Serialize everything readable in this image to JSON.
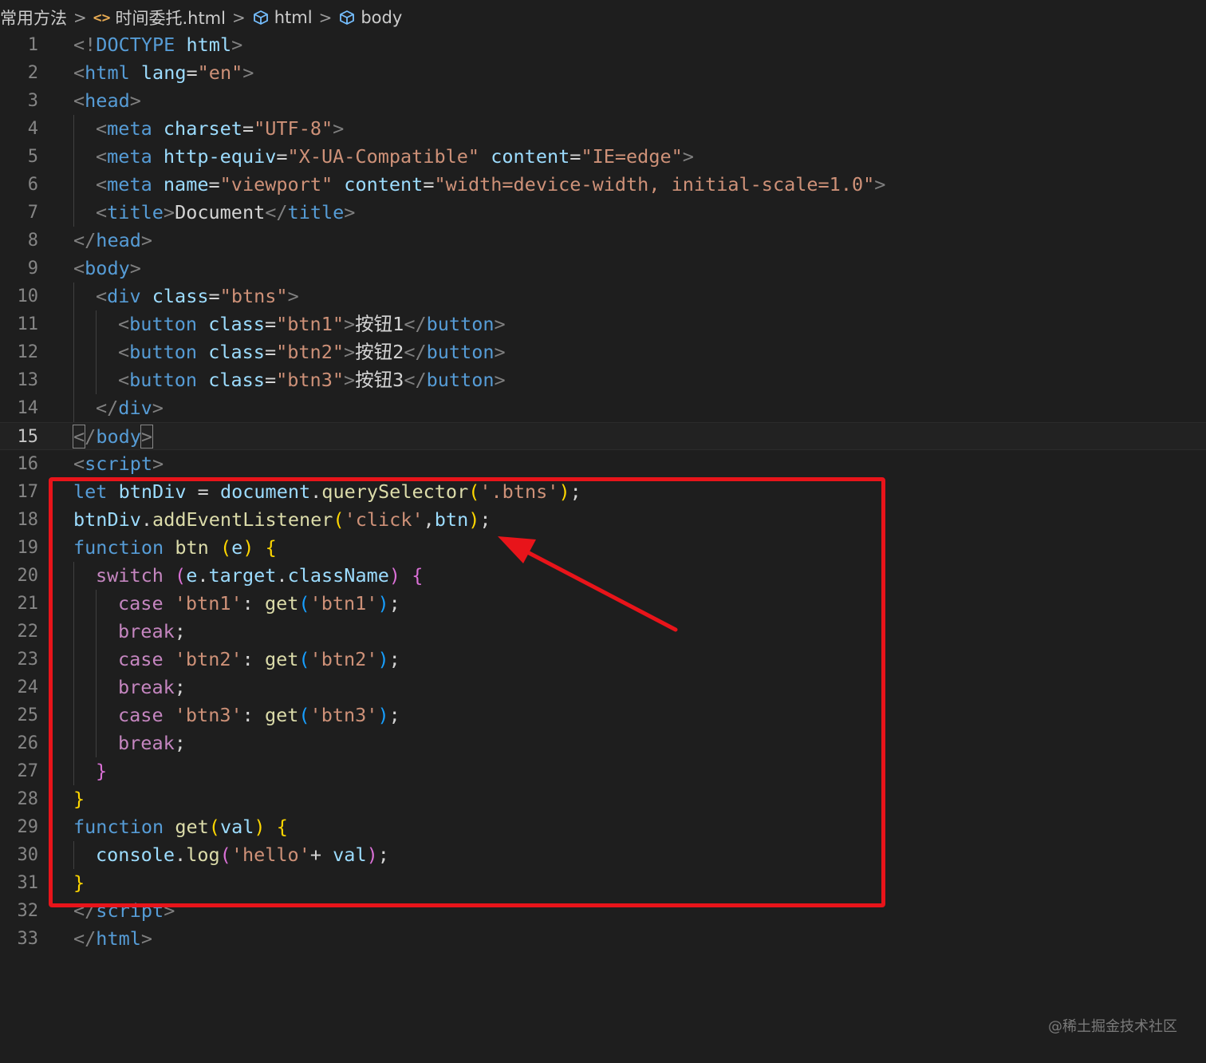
{
  "breadcrumb": {
    "folder": "常用方法",
    "file": "时间委托.html",
    "file_icon": "<>",
    "node1": "html",
    "node2": "body",
    "separator": ">"
  },
  "editor": {
    "current_line": 15,
    "lines": [
      {
        "n": "1",
        "indent": 0,
        "tokens": [
          [
            "punc",
            "<!"
          ],
          [
            "tag",
            "DOCTYPE"
          ],
          [
            "text",
            " "
          ],
          [
            "attr",
            "html"
          ],
          [
            "punc",
            ">"
          ]
        ]
      },
      {
        "n": "2",
        "indent": 0,
        "tokens": [
          [
            "punc",
            "<"
          ],
          [
            "tag",
            "html"
          ],
          [
            "text",
            " "
          ],
          [
            "attr",
            "lang"
          ],
          [
            "text",
            "="
          ],
          [
            "str",
            "\"en\""
          ],
          [
            "punc",
            ">"
          ]
        ]
      },
      {
        "n": "3",
        "indent": 0,
        "tokens": [
          [
            "punc",
            "<"
          ],
          [
            "tag",
            "head"
          ],
          [
            "punc",
            ">"
          ]
        ]
      },
      {
        "n": "4",
        "indent": 1,
        "tokens": [
          [
            "punc",
            "<"
          ],
          [
            "tag",
            "meta"
          ],
          [
            "text",
            " "
          ],
          [
            "attr",
            "charset"
          ],
          [
            "text",
            "="
          ],
          [
            "str",
            "\"UTF-8\""
          ],
          [
            "punc",
            ">"
          ]
        ]
      },
      {
        "n": "5",
        "indent": 1,
        "tokens": [
          [
            "punc",
            "<"
          ],
          [
            "tag",
            "meta"
          ],
          [
            "text",
            " "
          ],
          [
            "attr",
            "http-equiv"
          ],
          [
            "text",
            "="
          ],
          [
            "str",
            "\"X-UA-Compatible\""
          ],
          [
            "text",
            " "
          ],
          [
            "attr",
            "content"
          ],
          [
            "text",
            "="
          ],
          [
            "str",
            "\"IE=edge\""
          ],
          [
            "punc",
            ">"
          ]
        ]
      },
      {
        "n": "6",
        "indent": 1,
        "tokens": [
          [
            "punc",
            "<"
          ],
          [
            "tag",
            "meta"
          ],
          [
            "text",
            " "
          ],
          [
            "attr",
            "name"
          ],
          [
            "text",
            "="
          ],
          [
            "str",
            "\"viewport\""
          ],
          [
            "text",
            " "
          ],
          [
            "attr",
            "content"
          ],
          [
            "text",
            "="
          ],
          [
            "str",
            "\"width=device-width, initial-scale=1.0\""
          ],
          [
            "punc",
            ">"
          ]
        ]
      },
      {
        "n": "7",
        "indent": 1,
        "tokens": [
          [
            "punc",
            "<"
          ],
          [
            "tag",
            "title"
          ],
          [
            "punc",
            ">"
          ],
          [
            "text",
            "Document"
          ],
          [
            "punc",
            "</"
          ],
          [
            "tag",
            "title"
          ],
          [
            "punc",
            ">"
          ]
        ]
      },
      {
        "n": "8",
        "indent": 0,
        "tokens": [
          [
            "punc",
            "</"
          ],
          [
            "tag",
            "head"
          ],
          [
            "punc",
            ">"
          ]
        ]
      },
      {
        "n": "9",
        "indent": 0,
        "tokens": [
          [
            "punc",
            "<"
          ],
          [
            "tag",
            "body"
          ],
          [
            "punc",
            ">"
          ]
        ]
      },
      {
        "n": "10",
        "indent": 1,
        "tokens": [
          [
            "punc",
            "<"
          ],
          [
            "tag",
            "div"
          ],
          [
            "text",
            " "
          ],
          [
            "attr",
            "class"
          ],
          [
            "text",
            "="
          ],
          [
            "str",
            "\"btns\""
          ],
          [
            "punc",
            ">"
          ]
        ]
      },
      {
        "n": "11",
        "indent": 2,
        "tokens": [
          [
            "punc",
            "<"
          ],
          [
            "tag",
            "button"
          ],
          [
            "text",
            " "
          ],
          [
            "attr",
            "class"
          ],
          [
            "text",
            "="
          ],
          [
            "str",
            "\"btn1\""
          ],
          [
            "punc",
            ">"
          ],
          [
            "text",
            "按钮1"
          ],
          [
            "punc",
            "</"
          ],
          [
            "tag",
            "button"
          ],
          [
            "punc",
            ">"
          ]
        ]
      },
      {
        "n": "12",
        "indent": 2,
        "tokens": [
          [
            "punc",
            "<"
          ],
          [
            "tag",
            "button"
          ],
          [
            "text",
            " "
          ],
          [
            "attr",
            "class"
          ],
          [
            "text",
            "="
          ],
          [
            "str",
            "\"btn2\""
          ],
          [
            "punc",
            ">"
          ],
          [
            "text",
            "按钮2"
          ],
          [
            "punc",
            "</"
          ],
          [
            "tag",
            "button"
          ],
          [
            "punc",
            ">"
          ]
        ]
      },
      {
        "n": "13",
        "indent": 2,
        "tokens": [
          [
            "punc",
            "<"
          ],
          [
            "tag",
            "button"
          ],
          [
            "text",
            " "
          ],
          [
            "attr",
            "class"
          ],
          [
            "text",
            "="
          ],
          [
            "str",
            "\"btn3\""
          ],
          [
            "punc",
            ">"
          ],
          [
            "text",
            "按钮3"
          ],
          [
            "punc",
            "</"
          ],
          [
            "tag",
            "button"
          ],
          [
            "punc",
            ">"
          ]
        ]
      },
      {
        "n": "14",
        "indent": 1,
        "tokens": [
          [
            "punc",
            "</"
          ],
          [
            "tag",
            "div"
          ],
          [
            "punc",
            ">"
          ]
        ]
      },
      {
        "n": "15",
        "indent": 0,
        "tokens": [
          [
            "match",
            "<"
          ],
          [
            "punc",
            "/"
          ],
          [
            "tag",
            "body"
          ],
          [
            "match",
            ">"
          ]
        ]
      },
      {
        "n": "16",
        "indent": 0,
        "tokens": [
          [
            "punc",
            "<"
          ],
          [
            "tag",
            "script"
          ],
          [
            "punc",
            ">"
          ]
        ]
      },
      {
        "n": "17",
        "indent": 0,
        "tokens": [
          [
            "kw",
            "let"
          ],
          [
            "text",
            " "
          ],
          [
            "var",
            "btnDiv"
          ],
          [
            "op",
            " = "
          ],
          [
            "var",
            "document"
          ],
          [
            "op",
            "."
          ],
          [
            "fn",
            "querySelector"
          ],
          [
            "b1",
            "("
          ],
          [
            "str",
            "'.btns'"
          ],
          [
            "b1",
            ")"
          ],
          [
            "op",
            ";"
          ]
        ]
      },
      {
        "n": "18",
        "indent": 0,
        "tokens": [
          [
            "var",
            "btnDiv"
          ],
          [
            "op",
            "."
          ],
          [
            "fn",
            "addEventListener"
          ],
          [
            "b1",
            "("
          ],
          [
            "str",
            "'click'"
          ],
          [
            "op",
            ","
          ],
          [
            "var",
            "btn"
          ],
          [
            "b1",
            ")"
          ],
          [
            "op",
            ";"
          ]
        ]
      },
      {
        "n": "19",
        "indent": 0,
        "tokens": [
          [
            "kw",
            "function"
          ],
          [
            "text",
            " "
          ],
          [
            "fn",
            "btn"
          ],
          [
            "text",
            " "
          ],
          [
            "b1",
            "("
          ],
          [
            "var",
            "e"
          ],
          [
            "b1",
            ")"
          ],
          [
            "text",
            " "
          ],
          [
            "b1",
            "{"
          ]
        ]
      },
      {
        "n": "20",
        "indent": 1,
        "tokens": [
          [
            "ctrl",
            "switch"
          ],
          [
            "text",
            " "
          ],
          [
            "b2",
            "("
          ],
          [
            "var",
            "e"
          ],
          [
            "op",
            "."
          ],
          [
            "var",
            "target"
          ],
          [
            "op",
            "."
          ],
          [
            "var",
            "className"
          ],
          [
            "b2",
            ")"
          ],
          [
            "text",
            " "
          ],
          [
            "b2",
            "{"
          ]
        ]
      },
      {
        "n": "21",
        "indent": 2,
        "tokens": [
          [
            "ctrl",
            "case"
          ],
          [
            "text",
            " "
          ],
          [
            "str",
            "'btn1'"
          ],
          [
            "op",
            ": "
          ],
          [
            "fn",
            "get"
          ],
          [
            "b3",
            "("
          ],
          [
            "str",
            "'btn1'"
          ],
          [
            "b3",
            ")"
          ],
          [
            "op",
            ";"
          ]
        ]
      },
      {
        "n": "22",
        "indent": 2,
        "tokens": [
          [
            "ctrl",
            "break"
          ],
          [
            "op",
            ";"
          ]
        ]
      },
      {
        "n": "23",
        "indent": 2,
        "tokens": [
          [
            "ctrl",
            "case"
          ],
          [
            "text",
            " "
          ],
          [
            "str",
            "'btn2'"
          ],
          [
            "op",
            ": "
          ],
          [
            "fn",
            "get"
          ],
          [
            "b3",
            "("
          ],
          [
            "str",
            "'btn2'"
          ],
          [
            "b3",
            ")"
          ],
          [
            "op",
            ";"
          ]
        ]
      },
      {
        "n": "24",
        "indent": 2,
        "tokens": [
          [
            "ctrl",
            "break"
          ],
          [
            "op",
            ";"
          ]
        ]
      },
      {
        "n": "25",
        "indent": 2,
        "tokens": [
          [
            "ctrl",
            "case"
          ],
          [
            "text",
            " "
          ],
          [
            "str",
            "'btn3'"
          ],
          [
            "op",
            ": "
          ],
          [
            "fn",
            "get"
          ],
          [
            "b3",
            "("
          ],
          [
            "str",
            "'btn3'"
          ],
          [
            "b3",
            ")"
          ],
          [
            "op",
            ";"
          ]
        ]
      },
      {
        "n": "26",
        "indent": 2,
        "tokens": [
          [
            "ctrl",
            "break"
          ],
          [
            "op",
            ";"
          ]
        ]
      },
      {
        "n": "27",
        "indent": 1,
        "tokens": [
          [
            "b2",
            "}"
          ]
        ]
      },
      {
        "n": "28",
        "indent": 0,
        "tokens": [
          [
            "b1",
            "}"
          ]
        ]
      },
      {
        "n": "29",
        "indent": 0,
        "tokens": [
          [
            "kw",
            "function"
          ],
          [
            "text",
            " "
          ],
          [
            "fn",
            "get"
          ],
          [
            "b1",
            "("
          ],
          [
            "var",
            "val"
          ],
          [
            "b1",
            ")"
          ],
          [
            "text",
            " "
          ],
          [
            "b1",
            "{"
          ]
        ]
      },
      {
        "n": "30",
        "indent": 1,
        "tokens": [
          [
            "var",
            "console"
          ],
          [
            "op",
            "."
          ],
          [
            "fn",
            "log"
          ],
          [
            "b2",
            "("
          ],
          [
            "str",
            "'hello'"
          ],
          [
            "op",
            "+ "
          ],
          [
            "var",
            "val"
          ],
          [
            "b2",
            ")"
          ],
          [
            "op",
            ";"
          ]
        ]
      },
      {
        "n": "31",
        "indent": 0,
        "tokens": [
          [
            "b1",
            "}"
          ]
        ]
      },
      {
        "n": "32",
        "indent": 0,
        "tokens": [
          [
            "punc",
            "</"
          ],
          [
            "tag",
            "script"
          ],
          [
            "punc",
            ">"
          ]
        ]
      },
      {
        "n": "33",
        "indent": 0,
        "tokens": [
          [
            "punc",
            "</"
          ],
          [
            "tag",
            "html"
          ],
          [
            "punc",
            ">"
          ]
        ]
      }
    ]
  },
  "annotation": {
    "box_color": "#e8141a",
    "arrow_color": "#e8141a"
  },
  "watermark": "@稀土掘金技术社区"
}
